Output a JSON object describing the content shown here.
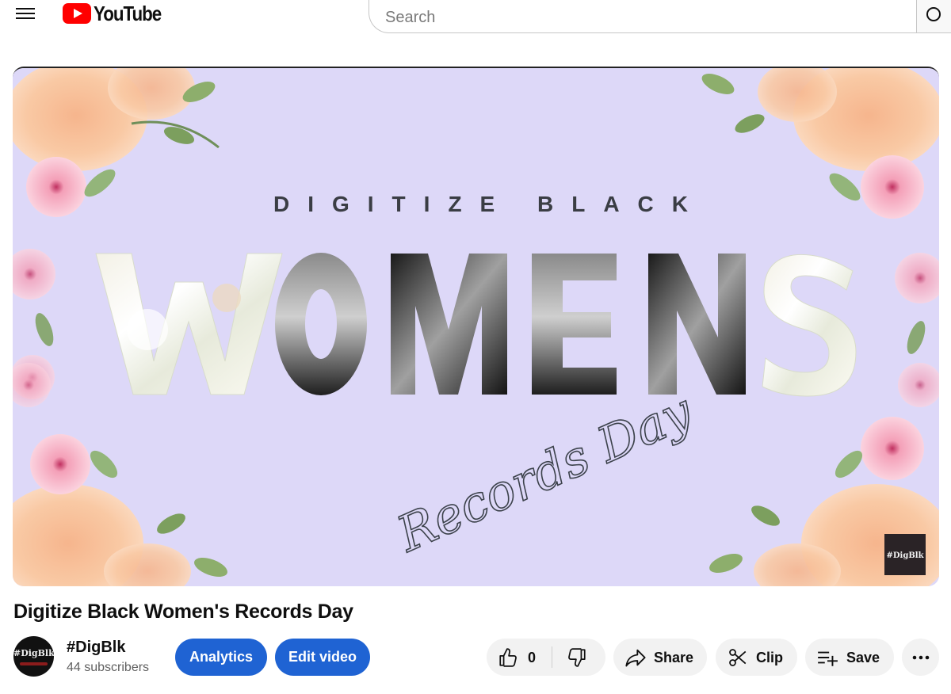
{
  "masthead": {
    "logo_text": "YouTube",
    "search_placeholder": "Search"
  },
  "player": {
    "overlay_top": "DIGITIZE BLACK",
    "overlay_main": "WOMENS",
    "overlay_script": "Records Day",
    "watermark": "#DigBlk",
    "background_color": "#ddd8f8"
  },
  "video": {
    "title": "Digitize Black Women's Records Day"
  },
  "channel": {
    "name": "#DigBlk",
    "subscribers": "44 subscribers",
    "avatar_text": "#DigBlk"
  },
  "actions": {
    "analytics": "Analytics",
    "edit_video": "Edit video",
    "like_count": "0",
    "share": "Share",
    "clip": "Clip",
    "save": "Save",
    "more_icon": "more-horizontal-icon"
  },
  "colors": {
    "brand_red": "#ff0000",
    "accent_blue": "#1f63d3",
    "pill_gray": "#f2f2f2"
  }
}
